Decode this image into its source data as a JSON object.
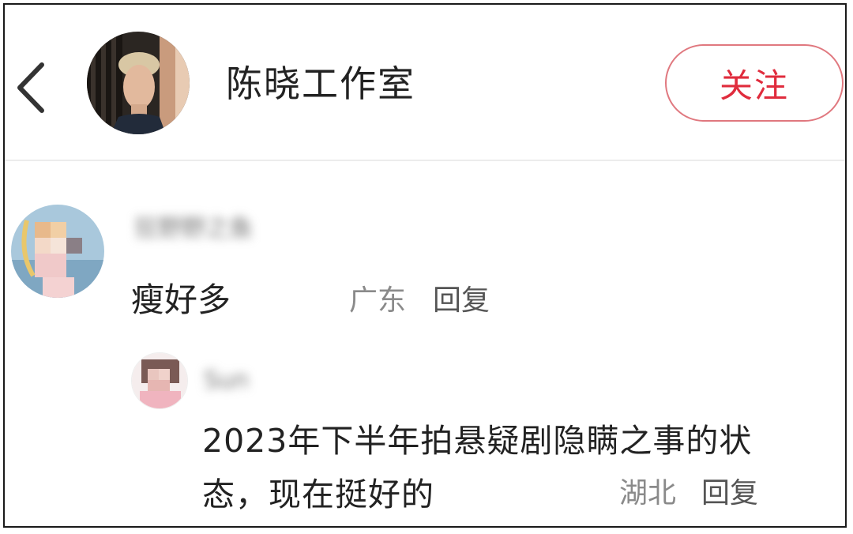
{
  "header": {
    "title": "陈晓工作室",
    "follow_label": "关注"
  },
  "comments": [
    {
      "username": "狂野野之鱼",
      "text": "瘦好多",
      "location": "广东",
      "reply_label": "回复",
      "replies": [
        {
          "username": "Sun",
          "text": "2023年下半年拍悬疑剧隐瞒之事的状态，现在挺好的",
          "location": "湖北",
          "reply_label": "回复"
        }
      ]
    }
  ],
  "colors": {
    "accent": "#e02c3d",
    "follow_border": "#e0787f"
  }
}
